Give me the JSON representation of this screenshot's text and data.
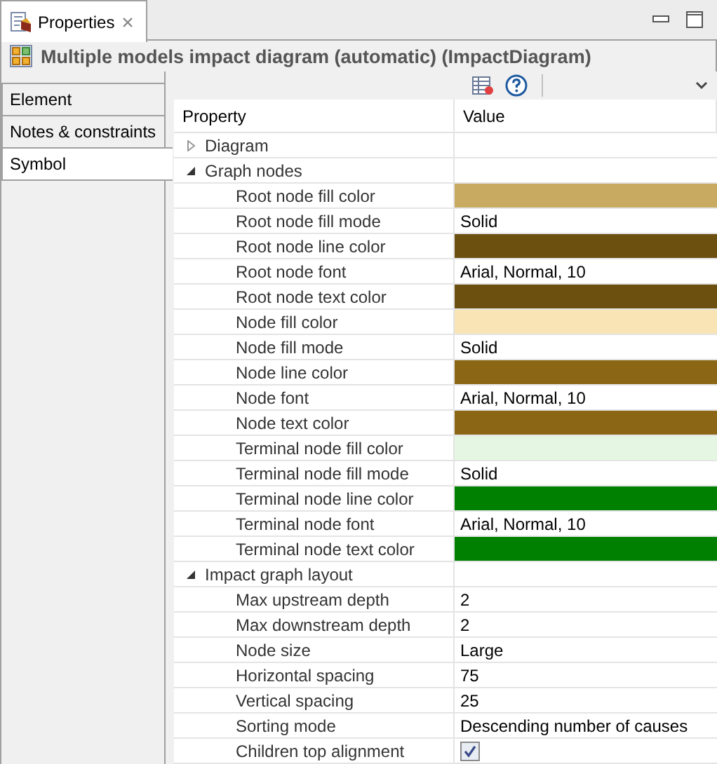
{
  "view_tab": {
    "title": "Properties",
    "selected": true
  },
  "header": {
    "title": "Multiple models impact diagram (automatic) (ImpactDiagram)"
  },
  "side_tabs": [
    {
      "label": "Element",
      "selected": false
    },
    {
      "label": "Notes & constraints",
      "selected": false
    },
    {
      "label": "Symbol",
      "selected": true
    }
  ],
  "table": {
    "columns": [
      "Property",
      "Value"
    ],
    "rows": [
      {
        "label": "Diagram",
        "kind": "group",
        "expanded": false
      },
      {
        "label": "Graph nodes",
        "kind": "group",
        "expanded": true,
        "children": [
          {
            "label": "Root node fill color",
            "kind": "color",
            "color": "#c8ab60"
          },
          {
            "label": "Root node fill mode",
            "kind": "text",
            "value": "Solid"
          },
          {
            "label": "Root node line color",
            "kind": "color",
            "color": "#6b5010"
          },
          {
            "label": "Root node font",
            "kind": "text",
            "value": "Arial, Normal, 10"
          },
          {
            "label": "Root node text color",
            "kind": "color",
            "color": "#6b5010"
          },
          {
            "label": "Node fill color",
            "kind": "color",
            "color": "#f9e4b6"
          },
          {
            "label": "Node fill mode",
            "kind": "text",
            "value": "Solid"
          },
          {
            "label": "Node line color",
            "kind": "color",
            "color": "#8b6614"
          },
          {
            "label": "Node font",
            "kind": "text",
            "value": "Arial, Normal, 10"
          },
          {
            "label": "Node text color",
            "kind": "color",
            "color": "#8b6614"
          },
          {
            "label": "Terminal node fill color",
            "kind": "color",
            "color": "#e5f7e2"
          },
          {
            "label": "Terminal node fill mode",
            "kind": "text",
            "value": "Solid"
          },
          {
            "label": "Terminal node line color",
            "kind": "color",
            "color": "#008000"
          },
          {
            "label": "Terminal node font",
            "kind": "text",
            "value": "Arial, Normal, 10"
          },
          {
            "label": "Terminal node text color",
            "kind": "color",
            "color": "#008000"
          }
        ]
      },
      {
        "label": "Impact graph layout",
        "kind": "group",
        "expanded": true,
        "children": [
          {
            "label": "Max upstream depth",
            "kind": "text",
            "value": "2"
          },
          {
            "label": "Max downstream depth",
            "kind": "text",
            "value": "2"
          },
          {
            "label": "Node size",
            "kind": "text",
            "value": "Large"
          },
          {
            "label": "Horizontal spacing",
            "kind": "text",
            "value": "75"
          },
          {
            "label": "Vertical spacing",
            "kind": "text",
            "value": "25"
          },
          {
            "label": "Sorting mode",
            "kind": "text",
            "value": "Descending number of causes"
          },
          {
            "label": "Children top alignment",
            "kind": "check",
            "checked": true
          }
        ]
      }
    ]
  }
}
